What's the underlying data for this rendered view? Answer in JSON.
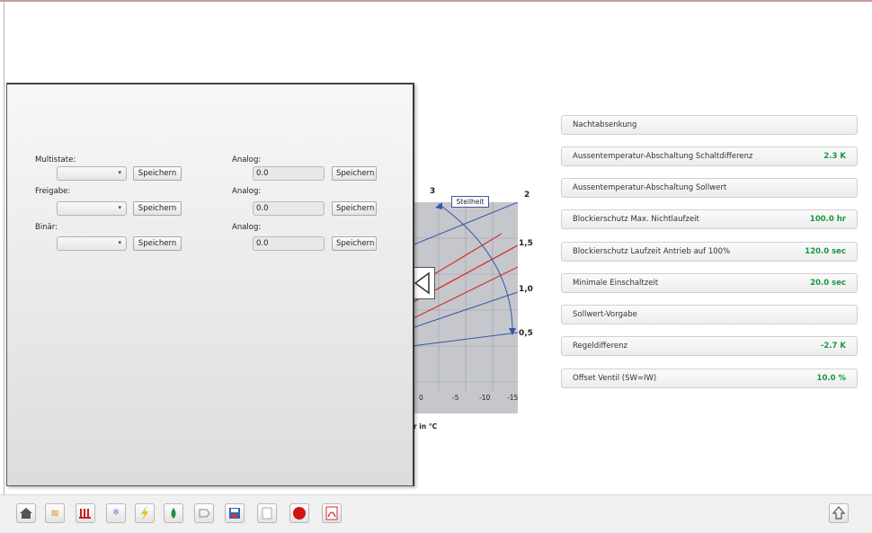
{
  "form": {
    "multistate_label": "Multistate:",
    "freigabe_label": "Freigabe:",
    "binaer_label": "Binär:",
    "analog_label": "Analog:",
    "save_label": "Speichern",
    "analog_values": [
      "0.0",
      "0.0",
      "0.0"
    ]
  },
  "chart": {
    "steilheit_label": "Steilheit",
    "curve_labels": [
      "3",
      "2",
      "1,5",
      "1,0",
      "0,5"
    ],
    "x_ticks": [
      "0",
      "-5",
      "-10",
      "-15"
    ],
    "axis_fragment": "r in °C"
  },
  "params": [
    {
      "label": "Nachtabsenkung",
      "value": ""
    },
    {
      "label": "Aussentemperatur-Abschaltung Schaltdifferenz",
      "value": "2.3 K"
    },
    {
      "label": "Aussentemperatur-Abschaltung Sollwert",
      "value": ""
    },
    {
      "label": "Blockierschutz Max. Nichtlaufzeit",
      "value": "100.0 hr"
    },
    {
      "label": "Blockierschutz Laufzeit Antrieb auf 100%",
      "value": "120.0 sec"
    },
    {
      "label": "Minimale Einschaltzeit",
      "value": "20.0 sec"
    },
    {
      "label": "Sollwert-Vorgabe",
      "value": ""
    },
    {
      "label": "Regeldifferenz",
      "value": "-2.7 K"
    },
    {
      "label": "Offset Ventil (SW=IW)",
      "value": "10.0 %"
    }
  ],
  "toolbar": {
    "icons": [
      "home-icon",
      "heating-icon",
      "radiator-icon",
      "snowflake-icon",
      "lightning-icon",
      "water-drop-icon",
      "tag-icon",
      "floppy-disk-icon",
      "blank-page-icon",
      "record-icon",
      "pdf-icon"
    ],
    "up_icon": "up-arrow-icon"
  },
  "colors": {
    "value_green": "#159940",
    "curve_red": "#d43434",
    "curve_blue": "#3355aa"
  }
}
